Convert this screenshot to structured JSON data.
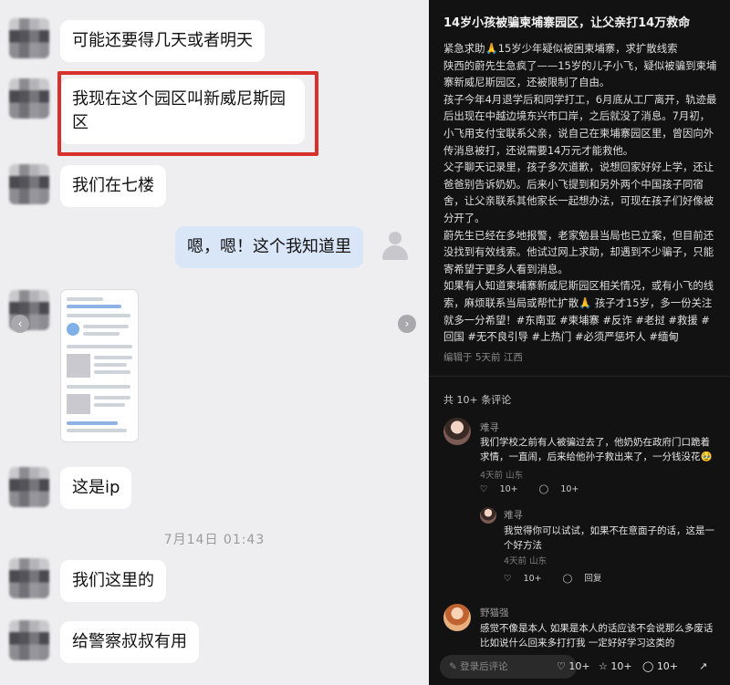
{
  "chat": {
    "messages": [
      {
        "text": "可能还要得几天或者明天"
      },
      {
        "text": "我现在这个园区叫新威尼斯园区"
      },
      {
        "text": "我们在七楼"
      },
      {
        "text": "嗯，嗯！这个我知道里"
      },
      {
        "text": "这是ip"
      },
      {
        "text": "我们这里的"
      },
      {
        "text": "给警察叔叔有用"
      }
    ],
    "timestamp": "7月14日 01:43",
    "highlight_color": "#d8302b",
    "self_bubble_color": "#d8e6f8"
  },
  "post": {
    "title": "14岁小孩被骗柬埔寨园区，让父亲打14万救命",
    "paragraphs": [
      "紧急求助🙏15岁少年疑似被困柬埔寨，求扩散线索",
      "陕西的蔚先生急疯了——15岁的儿子小飞，疑似被骗到柬埔寨新威尼斯园区，还被限制了自由。",
      "孩子今年4月退学后和同学打工，6月底从工厂离开，轨迹最后出现在中越边境东兴市口岸，之后就没了消息。7月初，小飞用支付宝联系父亲，说自己在柬埔寨园区里，曾因向外传消息被打，还说需要14万元才能救他。",
      "父子聊天记录里，孩子多次道歉，说想回家好好上学，还让爸爸别告诉奶奶。后来小飞提到和另外两个中国孩子同宿舍，让父亲联系其他家长一起想办法，可现在孩子们好像被分开了。",
      "蔚先生已经在多地报警，老家勉县当局也已立案，但目前还没找到有效线索。他试过网上求助，却遇到不少骗子，只能寄希望于更多人看到消息。",
      "如果有人知道柬埔寨新威尼斯园区相关情况，或有小飞的线索，麻烦联系当局或帮忙扩散🙏 孩子才15岁，多一份关注就多一分希望！"
    ],
    "tags": [
      "#东南亚",
      "#柬埔寨",
      "#反诈",
      "#老挝",
      "#救援",
      "#回国",
      "#无不良引导",
      "#上热门",
      "#必须严惩坏人",
      "#缅甸"
    ],
    "meta": "编辑于 5天前 江西",
    "comment_count": "共 10+ 条评论"
  },
  "comments": [
    {
      "name": "难寻",
      "text": "我们学校之前有人被骗过去了，他奶奶在政府门口跪着求情，一直闹，后来给他孙子救出来了，一分钱没花🥹",
      "meta": "4天前 山东",
      "likes": "10+",
      "replies": "10+"
    },
    {
      "name": "难寻",
      "text": "我觉得你可以试试，如果不在意面子的话，这是一个好方法",
      "meta": "4天前 山东",
      "likes": "10+",
      "reply_label": "回复"
    },
    {
      "name": "野猫强",
      "text": "感觉不像是本人 如果是本人的话应该不会说那么多废话 比如说什么回来多打打我 一定好好学习这类的"
    }
  ],
  "bottom_bar": {
    "placeholder": "登录后评论",
    "likes": "10+",
    "stars": "10+",
    "comments": "10+"
  },
  "icons": [
    "left-arrow-icon",
    "right-arrow-icon",
    "user-icon",
    "heart-icon",
    "star-icon",
    "comment-icon",
    "edit-icon",
    "share-icon"
  ]
}
